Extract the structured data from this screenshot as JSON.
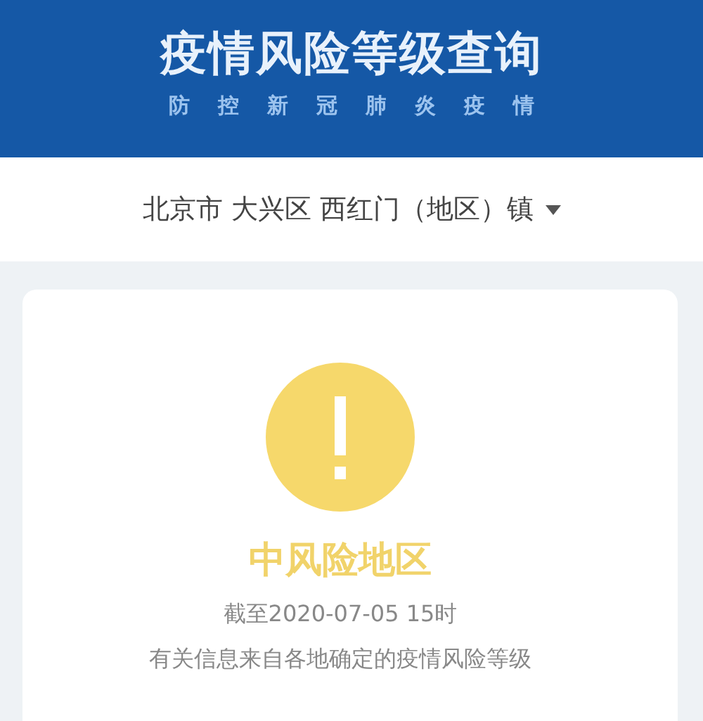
{
  "header": {
    "title": "疫情风险等级查询",
    "subtitle": [
      "防",
      "控",
      "新",
      "冠",
      "肺",
      "炎",
      "疫",
      "情"
    ]
  },
  "location": {
    "label": "北京市 大兴区 西红门（地区）镇"
  },
  "result": {
    "kind": "medium",
    "level_text": "中风险地区",
    "as_of": "截至2020-07-05 15时",
    "note": "有关信息来自各地确定的疫情风险等级"
  }
}
